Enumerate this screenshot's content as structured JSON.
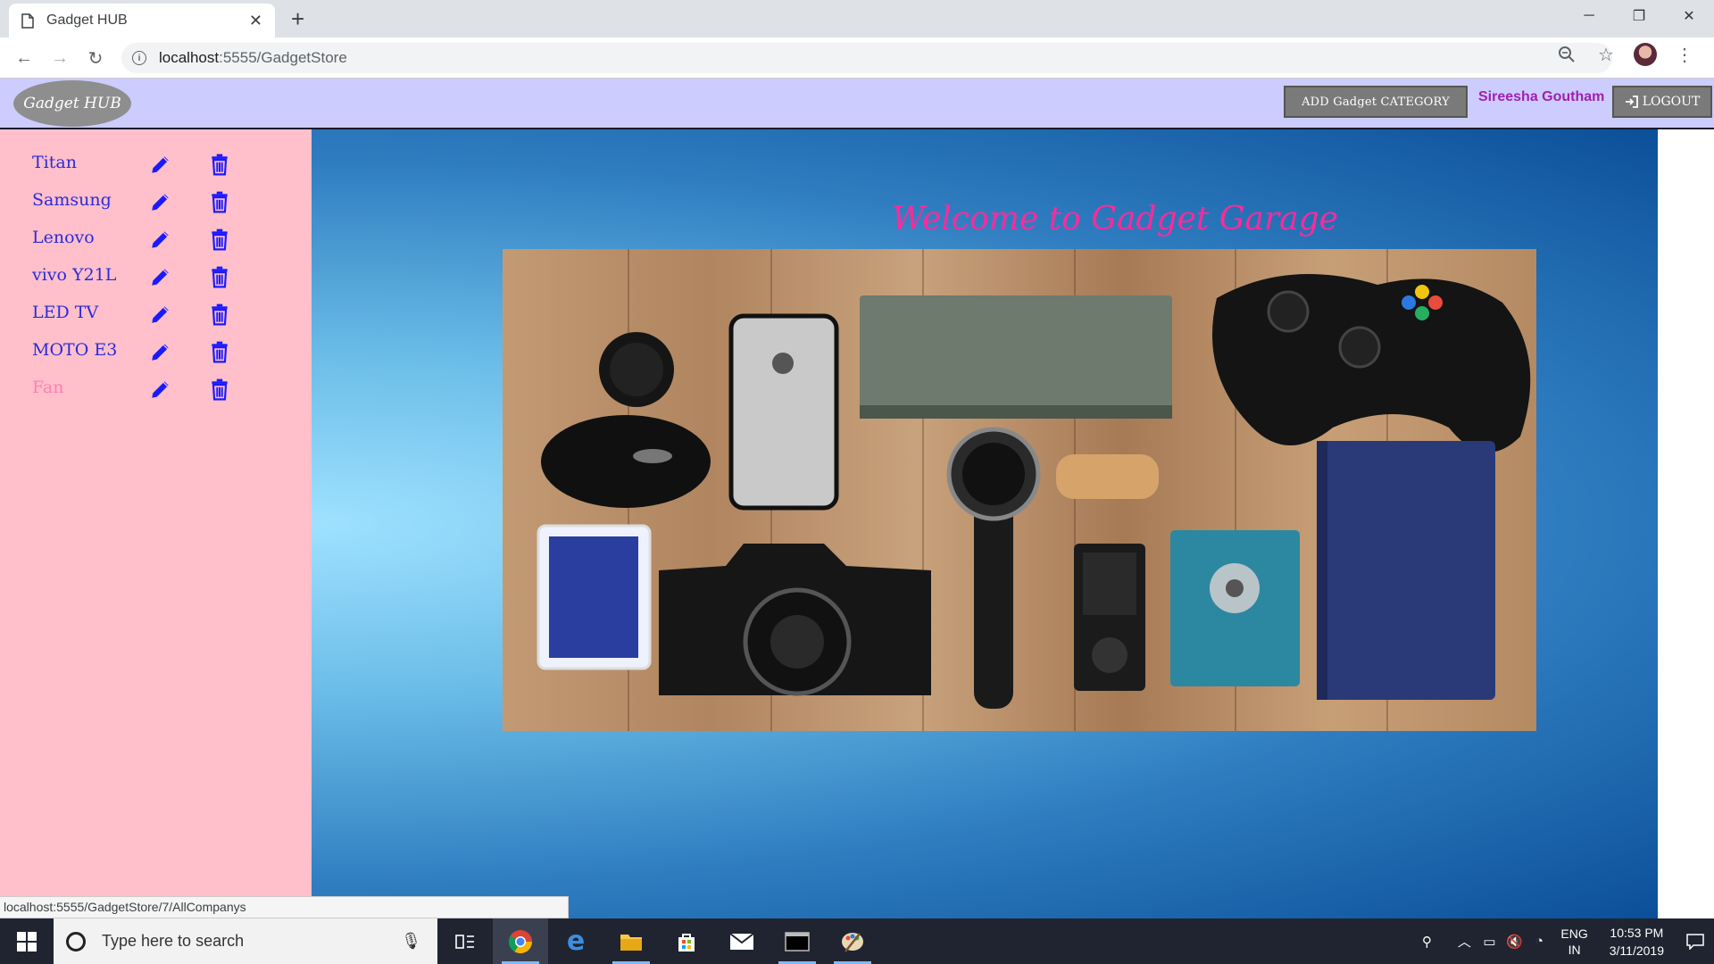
{
  "browser": {
    "tab_title": "Gadget HUB",
    "tab_close": "✕",
    "new_tab": "+",
    "url_host": "localhost",
    "url_path": ":5555/GadgetStore",
    "status_url": "localhost:5555/GadgetStore/7/AllCompanys"
  },
  "header": {
    "brand": "Gadget HUB",
    "add_category_label": "ADD Gadget CATEGORY",
    "user_name": "Sireesha Goutham",
    "logout_label": "LOGOUT"
  },
  "sidebar": {
    "items": [
      {
        "label": "Titan"
      },
      {
        "label": "Samsung"
      },
      {
        "label": "Lenovo"
      },
      {
        "label": "vivo Y21L"
      },
      {
        "label": "LED TV"
      },
      {
        "label": "MOTO E3"
      },
      {
        "label": "Fan"
      }
    ],
    "edit_icon": "pencil-icon",
    "delete_icon": "trash-icon"
  },
  "main": {
    "welcome": "Welcome to Gadget Garage"
  },
  "taskbar": {
    "search_placeholder": "Type here to search",
    "lang_1": "ENG",
    "lang_2": "IN",
    "time": "10:53 PM",
    "date": "3/11/2019"
  },
  "colors": {
    "header_bg": "#ccccff",
    "sidebar_bg": "#ffc0cb",
    "link": "#2b2bd6",
    "welcome": "#ff2a9a",
    "user": "#a020b0"
  }
}
